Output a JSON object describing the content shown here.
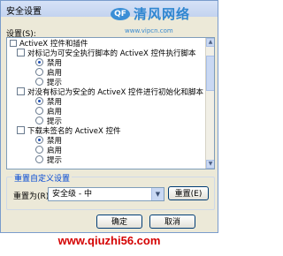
{
  "window": {
    "title": "安全设置"
  },
  "watermark": {
    "logo": "QF",
    "name": "清风网络",
    "url": "www.vipcn.com"
  },
  "settings_label": "设置(S):",
  "tree": {
    "group_activex": "ActiveX 控件和插件",
    "items": [
      {
        "label": "对标记为可安全执行脚本的 ActiveX 控件执行脚本",
        "options": [
          {
            "label": "禁用",
            "selected": true
          },
          {
            "label": "启用",
            "selected": false
          },
          {
            "label": "提示",
            "selected": false
          }
        ]
      },
      {
        "label": "对没有标记为安全的 ActiveX 控件进行初始化和脚本",
        "options": [
          {
            "label": "禁用",
            "selected": true
          },
          {
            "label": "启用",
            "selected": false
          },
          {
            "label": "提示",
            "selected": false
          }
        ]
      },
      {
        "label": "下载未签名的 ActiveX 控件",
        "options": [
          {
            "label": "禁用",
            "selected": true
          },
          {
            "label": "启用",
            "selected": false
          },
          {
            "label": "提示",
            "selected": false
          }
        ]
      }
    ]
  },
  "custom_reset": {
    "group_title": "重置自定义设置",
    "reset_to_label": "重置为(R):",
    "level_value": "安全级 - 中",
    "reset_button": "重置(E)"
  },
  "buttons": {
    "ok": "确定",
    "cancel": "取消"
  },
  "footer": {
    "url": "www.qiuzhi56.com"
  }
}
